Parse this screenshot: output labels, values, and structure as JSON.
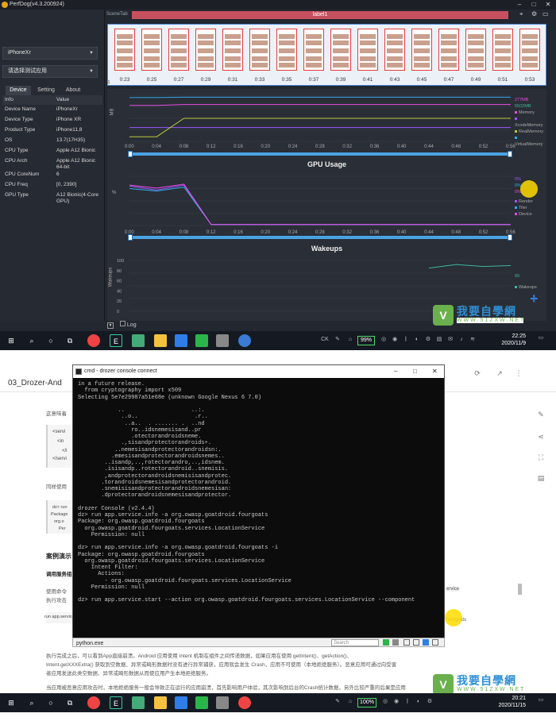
{
  "perfdog": {
    "window_title": "PerfDog(v4.3.200924)",
    "device_select": "iPhoneXr",
    "app_select": "请选择测试应用",
    "tabs": [
      "Device",
      "Setting",
      "About"
    ],
    "info_header": {
      "key": "Info",
      "value": "Value"
    },
    "info_rows": [
      {
        "k": "Device Name",
        "v": "iPhoneXr"
      },
      {
        "k": "Device Type",
        "v": "iPhone XR"
      },
      {
        "k": "Product Type",
        "v": "iPhone11,8"
      },
      {
        "k": "OS",
        "v": "13.7(17H35)"
      },
      {
        "k": "CPU Type",
        "v": "Apple A12 Bionic"
      },
      {
        "k": "CPU Arch",
        "v": "Apple A12 Bionic 64-bit"
      },
      {
        "k": "CPU CoreNum",
        "v": "6"
      },
      {
        "k": "CPU Freq",
        "v": "[0, 2390]"
      },
      {
        "k": "GPU Type",
        "v": "A12 Bionic(4-Core GPU)"
      }
    ],
    "scene_tab": "SceneTab",
    "label_bar": "label1",
    "filmstrip_times": [
      "0:23",
      "0:25",
      "0:27",
      "0:29",
      "0:31",
      "0:33",
      "0:35",
      "0:37",
      "0:39",
      "0:41",
      "0:43",
      "0:45",
      "0:47",
      "0:49",
      "0:51",
      "0:53"
    ],
    "filmstrip_start": "1",
    "log_label": "Log"
  },
  "chart_data": [
    {
      "type": "line",
      "title": "",
      "ylabel": "MB",
      "x": [
        "0:00",
        "0:04",
        "0:08",
        "0:12",
        "0:16",
        "0:20",
        "0:24",
        "0:28",
        "0:32",
        "0:36",
        "0:40",
        "0:44",
        "0:48",
        "0:52",
        "0:56"
      ],
      "legend_values": [
        "277MB",
        "5502MB"
      ],
      "series": [
        {
          "name": "Memory",
          "color": "#e84de6",
          "values": [
            0.78,
            0.78,
            0.8,
            0.8,
            0.8,
            0.8,
            0.8,
            0.8,
            0.8,
            0.8,
            0.8,
            0.8,
            0.8,
            0.8,
            0.8
          ]
        },
        {
          "name": "XcodeMemory",
          "color": "#9b59ff",
          "values": [
            0.3,
            0.3,
            0.3,
            0.3,
            0.3,
            0.3,
            0.3,
            0.3,
            0.3,
            0.3,
            0.3,
            0.3,
            0.3,
            0.3,
            0.3
          ]
        },
        {
          "name": "RealMemory",
          "color": "#b8c93a",
          "values": [
            0.1,
            0.1,
            0.5,
            0.5,
            0.5,
            0.5,
            0.5,
            0.5,
            0.5,
            0.5,
            0.5,
            0.5,
            0.5,
            0.5,
            0.5
          ]
        },
        {
          "name": "VirtualMemory",
          "color": "#2fa9e8",
          "values": [
            0.95,
            0.95,
            0.96,
            0.96,
            0.96,
            0.96,
            0.96,
            0.96,
            0.96,
            0.96,
            0.96,
            0.96,
            0.96,
            0.96,
            0.96
          ]
        }
      ]
    },
    {
      "type": "line",
      "title": "GPU Usage",
      "ylabel": "%",
      "x": [
        "0:00",
        "0:04",
        "0:08",
        "0:12",
        "0:16",
        "0:20",
        "0:24",
        "0:28",
        "0:32",
        "0:36",
        "0:40",
        "0:44",
        "0:48",
        "0:52",
        "0:56"
      ],
      "legend_values": [
        "0%",
        "0%",
        "0%"
      ],
      "series": [
        {
          "name": "Render",
          "color": "#9b59ff",
          "values": [
            0.8,
            0.72,
            0.82,
            0.02,
            0.02,
            0.02,
            0.02,
            0.02,
            0.02,
            0.02,
            0.02,
            0.02,
            0.02,
            0.02,
            0.02
          ]
        },
        {
          "name": "Tiler",
          "color": "#2fa9e8",
          "values": [
            0.75,
            0.7,
            0.78,
            0.02,
            0.02,
            0.02,
            0.02,
            0.02,
            0.02,
            0.02,
            0.02,
            0.02,
            0.02,
            0.02,
            0.02
          ]
        },
        {
          "name": "Device",
          "color": "#e84de6",
          "values": [
            0.82,
            0.76,
            0.84,
            0.02,
            0.02,
            0.02,
            0.02,
            0.02,
            0.02,
            0.02,
            0.02,
            0.02,
            0.02,
            0.02,
            0.02
          ]
        }
      ]
    },
    {
      "type": "line",
      "title": "Wakeups",
      "ylabel": "Wakeups",
      "yticks": [
        "100",
        "80",
        "60",
        "40",
        "20",
        "0"
      ],
      "legend_values": [
        "89"
      ],
      "series": [
        {
          "name": "Wakeups",
          "color": "#3fb6a0",
          "values": [
            null,
            null,
            null,
            null,
            null,
            null,
            null,
            null,
            null,
            null,
            null,
            0.85,
            0.92,
            0.88,
            0.9
          ]
        }
      ]
    }
  ],
  "taskbar_top": {
    "battery": "99%",
    "time": "22:25",
    "date": "2020/11/9",
    "lang": "CK"
  },
  "taskbar_bottom": {
    "battery": "100%",
    "time": "20:21",
    "date": "2020/11/15"
  },
  "watermark": {
    "big": "我要自學網",
    "url": "W W W . 5 1 Z X W . N E T"
  },
  "doc": {
    "title": "03_Drozer-And",
    "p1": "这意味着",
    "heading_case": "案例演示",
    "heading_sub": "调用服务组",
    "p2": "使用命令",
    "p3": "执行攻击",
    "p_after": "执行完成之后，可以看到App直接崩溃。Android 应用使用 Intent 机制在组件之间传递数据，如果应用在使用 getIntent()、getAction()、",
    "p_after2": "Intent.getXXXExtra() 获取到空数据、异常或畸形数据时没有进行异常捕获，应用就会发生 Crash，应用不可使用（本地拒绝服务）。恶意应用可通过向受害",
    "p_after3": "者应用发送此类空数据、异常或畸形数据从而使应用产生本地拒绝服务。",
    "p_last": "当应用被恶意应用攻击时，本地拒绝服务一般会导致正在运行的应用崩溃，首先影响用户体验，其次影响到后台的Crash统计数据，另外比较严重的后果是应用",
    "code_prefix": "ervice",
    "code_prefix2": "run app.service",
    "code_suffix": "fourgoats"
  },
  "cmd": {
    "title": "cmd - drozer  console connect",
    "status_tab": "python.exe",
    "search_placeholder": "Search",
    "lines": [
      "in a future release.",
      "  from cryptography import x509",
      "Selecting 5e7e29987a51e68e (unknown Google Nexus 6 7.0)",
      "",
      "            ..                    ..:.",
      "             ..o..                 .r..",
      "              ..a..  . ....... .  ..nd",
      "                ro..idsnemesisand..pr",
      "                .otectorandroidsneme.",
      "             .,sisandprotectorandroids+.",
      "           ..nemesisandprotectorandroidsn:.",
      "          .emesisandprotectorandroidsnemes..",
      "        ..isandp,..,rotectorandro,..,idsnem.",
      "        .isisandp..rotectorandroid..snemisis.",
      "        ,andprotectorandroidsnemisisandprotec.",
      "       .torandroidsnemesisandprotectorandroid.",
      "       .snemisisandprotectorandroidsnemesisan:",
      "       .dprotectorandroidsnemesisandprotector.",
      "",
      "drozer Console (v2.4.4)",
      "dz> run app.service.info -a org.owasp.goatdroid.fourgoats",
      "Package: org.owasp.goatdroid.fourgoats",
      "  org.owasp.goatdroid.fourgoats.services.LocationService",
      "    Permission: null",
      "",
      "dz> run app.service.info -a org.owasp.goatdroid.fourgoats -i",
      "Package: org.owasp.goatdroid.fourgoats",
      "  org.owasp.goatdroid.fourgoats.services.LocationService",
      "    Intent Filter:",
      "      Actions:",
      "        - org.owasp.goatdroid.fourgoats.services.LocationService",
      "    Permission: null",
      "",
      "dz> run app.service.start --action org.owasp.goatdroid.fourgoats.services.LocationService --component"
    ]
  }
}
